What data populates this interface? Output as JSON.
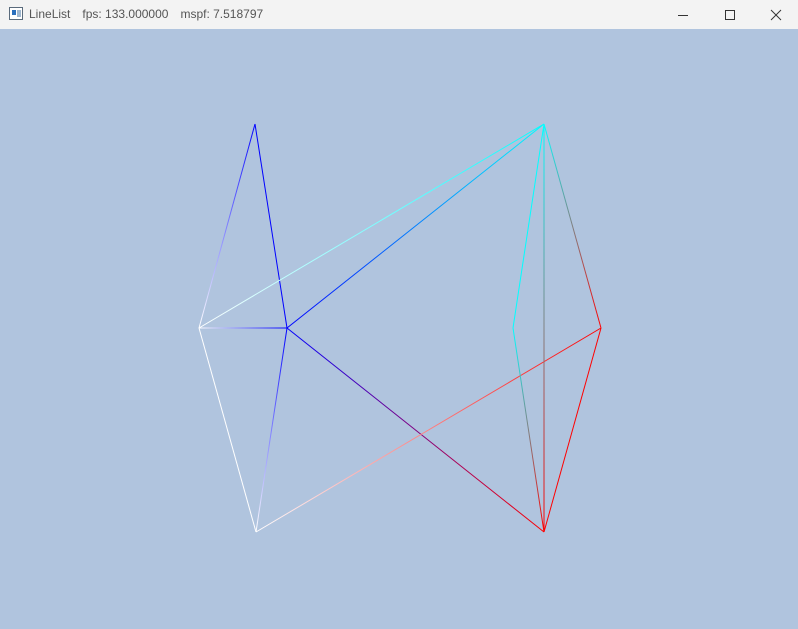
{
  "window": {
    "app_name": "LineList",
    "fps_text": "fps: 133.000000",
    "mspf_text": "mspf: 7.518797",
    "minimize_icon": "minimize-icon",
    "maximize_icon": "maximize-icon",
    "close_icon": "close-icon"
  },
  "viewport": {
    "background_color": "#b0c4de",
    "colors": {
      "white": "#ffffff",
      "blue": "#0000ff",
      "cyan": "#00ffff",
      "red": "#ff0000"
    }
  }
}
